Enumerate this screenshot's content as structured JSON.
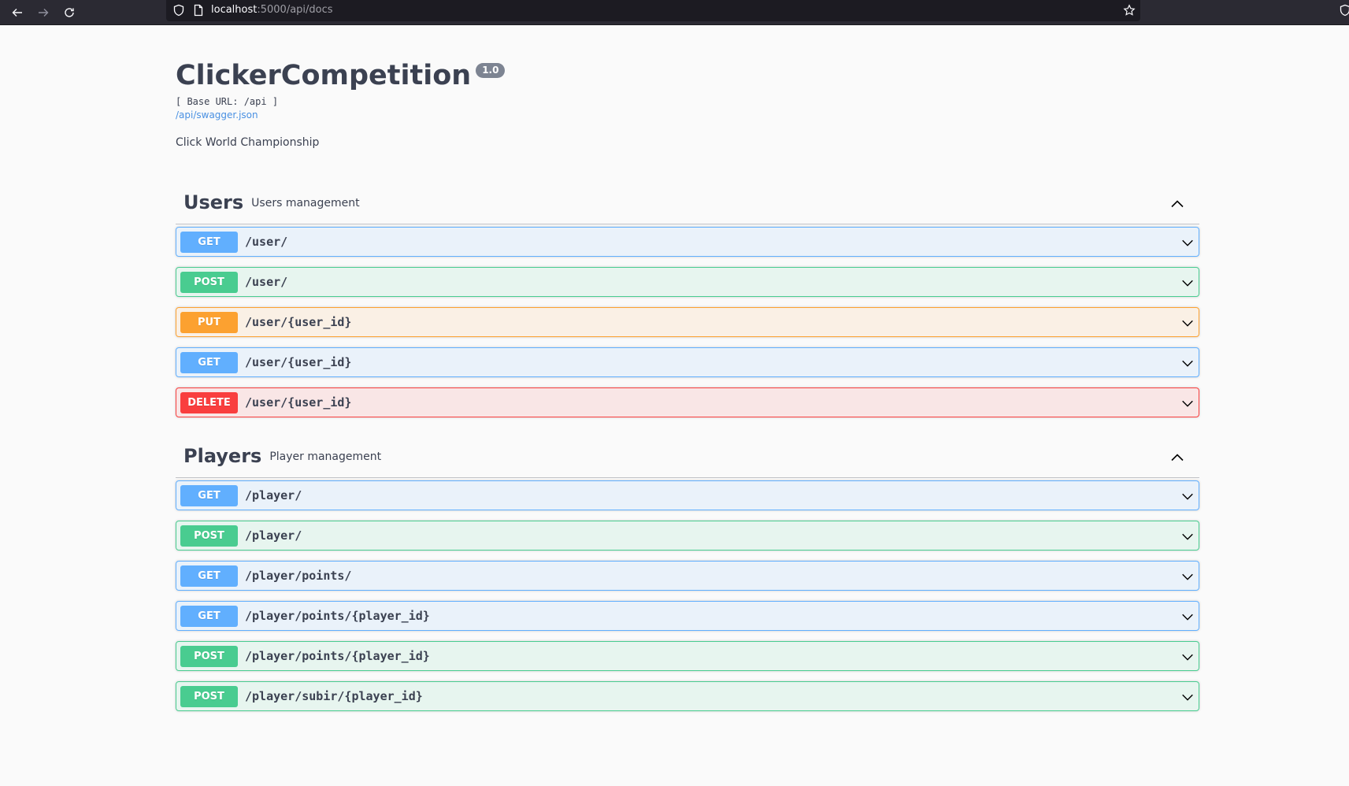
{
  "browser": {
    "url_host": "localhost",
    "url_rest": ":5000/api/docs"
  },
  "info": {
    "title": "ClickerCompetition",
    "version": "1.0",
    "base_url": "[ Base URL: /api ]",
    "spec_link": "/api/swagger.json",
    "description": "Click World Championship"
  },
  "tags": [
    {
      "name": "Users",
      "description": "Users management",
      "operations": [
        {
          "method": "GET",
          "path": "/user/"
        },
        {
          "method": "POST",
          "path": "/user/"
        },
        {
          "method": "PUT",
          "path": "/user/{user_id}"
        },
        {
          "method": "GET",
          "path": "/user/{user_id}"
        },
        {
          "method": "DELETE",
          "path": "/user/{user_id}"
        }
      ]
    },
    {
      "name": "Players",
      "description": "Player management",
      "operations": [
        {
          "method": "GET",
          "path": "/player/"
        },
        {
          "method": "POST",
          "path": "/player/"
        },
        {
          "method": "GET",
          "path": "/player/points/"
        },
        {
          "method": "GET",
          "path": "/player/points/{player_id}"
        },
        {
          "method": "POST",
          "path": "/player/points/{player_id}"
        },
        {
          "method": "POST",
          "path": "/player/subir/{player_id}"
        }
      ]
    }
  ],
  "colors": {
    "get": "#61affe",
    "post": "#49cc90",
    "put": "#fca130",
    "delete": "#f93e3e"
  }
}
